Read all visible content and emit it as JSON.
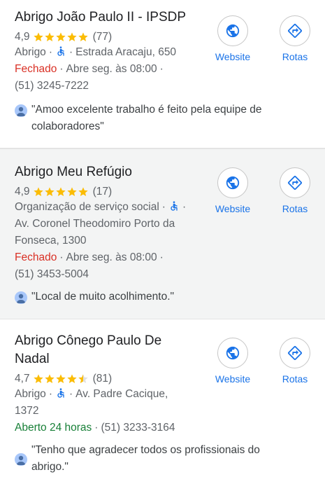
{
  "colors": {
    "accent": "#1a73e8",
    "star": "#fbbc04",
    "closed": "#d93025",
    "open": "#188038",
    "highlight_bg": "#f3f4f4"
  },
  "actions": {
    "website_label": "Website",
    "directions_label": "Rotas"
  },
  "places": [
    {
      "name": "Abrigo João Paulo II - IPSDP",
      "rating": "4,9",
      "stars": 5,
      "reviews_count": "(77)",
      "category": "Abrigo",
      "address": "Estrada Aracaju, 650",
      "status": "Fechado",
      "hours_note": "Abre seg. às 08:00",
      "phone": "(51) 3245-7222",
      "review": "\"Amoo excelente trabalho é feito pela equipe de colaboradores\""
    },
    {
      "name": "Abrigo Meu Refúgio",
      "rating": "4,9",
      "stars": 5,
      "reviews_count": "(17)",
      "category": "Organização de serviço social",
      "address": "Av. Coronel Theodomiro Porto da Fonseca, 1300",
      "status": "Fechado",
      "hours_note": "Abre seg. às 08:00",
      "phone": "(51) 3453-5004",
      "review": "\"Local de muito acolhimento.\""
    },
    {
      "name": "Abrigo Cônego Paulo De Nadal",
      "rating": "4,7",
      "stars": 4.5,
      "reviews_count": "(81)",
      "category": "Abrigo",
      "address": "Av. Padre Cacique, 1372",
      "status": "Aberto 24 horas",
      "phone": "(51) 3233-3164",
      "review": "\"Tenho que agradecer todos os profissionais do abrigo.\""
    }
  ]
}
